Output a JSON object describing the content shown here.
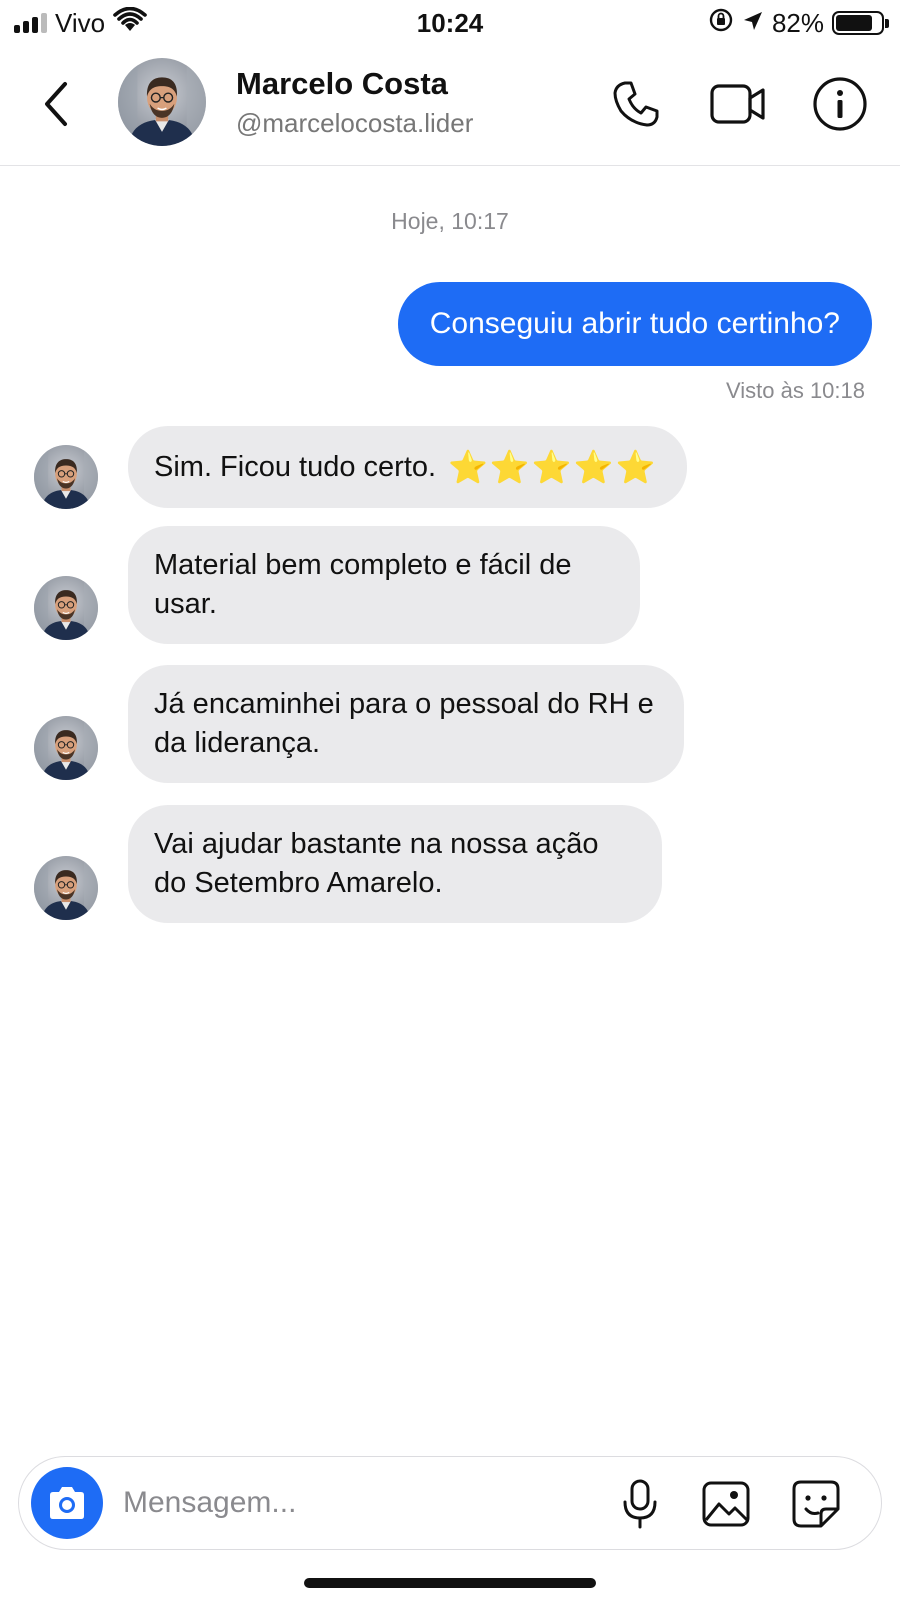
{
  "status_bar": {
    "carrier": "Vivo",
    "time": "10:24",
    "battery_percent": "82%",
    "battery_level": 0.82,
    "icons": [
      "signal-icon",
      "wifi-icon",
      "orientation-lock-icon",
      "location-icon",
      "battery-icon"
    ]
  },
  "header": {
    "name": "Marcelo Costa",
    "handle": "@marcelocosta.lider",
    "icons": [
      "back-chevron-icon",
      "phone-icon",
      "video-camera-icon",
      "info-icon"
    ]
  },
  "chat": {
    "timestamp": "Hoje, 10:17",
    "outgoing": {
      "text": "Conseguiu abrir tudo certinho?",
      "seen": "Visto às 10:18"
    },
    "incoming": [
      {
        "text": "Sim. Ficou tudo certo.",
        "stars": "⭐⭐⭐⭐⭐"
      },
      {
        "text": "Material bem completo e fácil de usar."
      },
      {
        "text": "Já encaminhei para o pessoal do RH e da liderança."
      },
      {
        "text": "Vai ajudar bastante na nossa ação do Setembro Amarelo."
      }
    ]
  },
  "composer": {
    "placeholder": "Mensagem...",
    "icons": [
      "camera-icon",
      "microphone-icon",
      "gallery-icon",
      "sticker-icon"
    ]
  },
  "colors": {
    "accent": "#1e6cf5",
    "incoming_bubble": "#eaeaec",
    "secondary_text": "#8a8a8e",
    "star": "#f5c518"
  }
}
